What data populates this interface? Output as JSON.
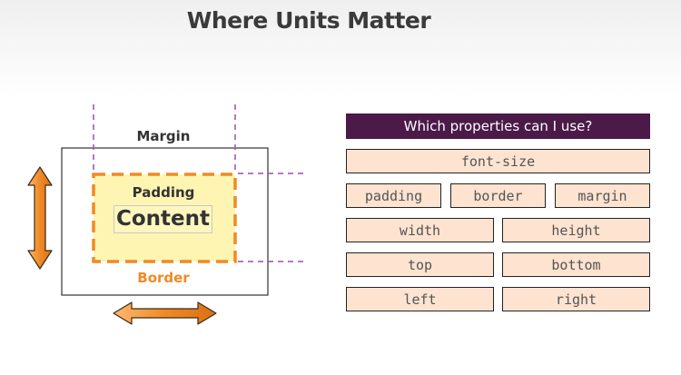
{
  "title": "Where Units Matter",
  "diagram": {
    "margin_label": "Margin",
    "padding_label": "Padding",
    "content_label": "Content",
    "border_label": "Border"
  },
  "panel": {
    "header": "Which properties can I use?",
    "properties": [
      "font-size",
      "padding",
      "border",
      "margin",
      "width",
      "height",
      "top",
      "bottom",
      "left",
      "right"
    ]
  },
  "colors": {
    "header_bg": "#4b1a49",
    "chip_bg": "#fde3d0",
    "accent_orange": "#f08a24",
    "guide_purple": "#9b4fb0",
    "content_fill": "#fff5b3"
  }
}
